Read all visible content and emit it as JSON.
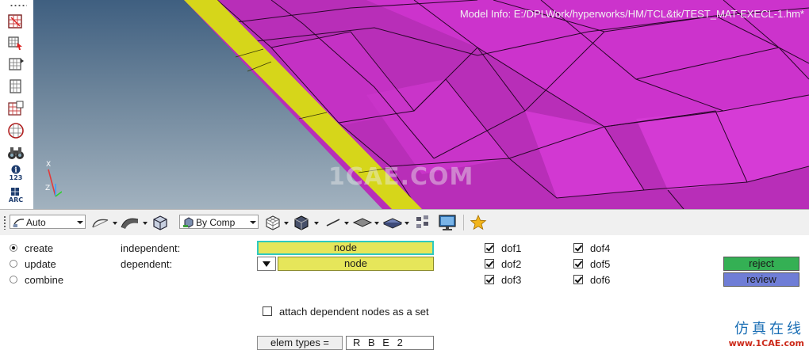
{
  "viewport": {
    "model_info": "Model Info: E:/DPLWork/hyperworks/HM/TCL&tk/TEST_MAT-EXECL-1.hm*",
    "watermark": "1CAE.COM",
    "axis_labels": {
      "x": "X",
      "z": "Z"
    }
  },
  "side_toolbar": {
    "info_badge_text": "i",
    "count_label": "123",
    "arc_label": "ARC",
    "icons": [
      "window-select-icon",
      "rotate-view-icon",
      "pan-icon",
      "zoom-icon",
      "section-icon",
      "circle-select-icon",
      "binoculars-icon",
      "info-icon",
      "arc-icon"
    ]
  },
  "toolbar": {
    "display_mode": "Auto",
    "color_mode": "By Comp",
    "icons": [
      "wireframe-mode-icon",
      "shaded-mode-icon",
      "box-icon",
      "by-comp-icon",
      "wire-cube-icon",
      "solid-cube-icon",
      "line-icon",
      "plane-icon",
      "shell-icon",
      "tree-icon",
      "monitor-icon",
      "star-icon"
    ]
  },
  "panel": {
    "modes": [
      {
        "label": "create",
        "selected": true
      },
      {
        "label": "update",
        "selected": false
      },
      {
        "label": "combine",
        "selected": false
      }
    ],
    "independent_label": "independent:",
    "dependent_label": "dependent:",
    "independent_value": "node",
    "dependent_value": "node",
    "dofs_col1": [
      {
        "label": "dof1",
        "checked": true
      },
      {
        "label": "dof2",
        "checked": true
      },
      {
        "label": "dof3",
        "checked": true
      }
    ],
    "dofs_col2": [
      {
        "label": "dof4",
        "checked": true
      },
      {
        "label": "dof5",
        "checked": true
      },
      {
        "label": "dof6",
        "checked": true
      }
    ],
    "attach_label": "attach dependent nodes as a set",
    "attach_checked": false,
    "elem_types_label": "elem types =",
    "elem_types_value": "R B E 2",
    "reject_label": "reject",
    "review_label": "review",
    "brand_cn": "仿真在线",
    "brand_url": "www.1CAE.com"
  },
  "colors": {
    "reject_bg": "#34b054",
    "review_bg": "#6f7dd6",
    "select_bg": "#e6e65a",
    "mesh_main": "#cc33cc",
    "mesh_dark": "#a529a5",
    "mesh_edge": "#d6d61a"
  }
}
